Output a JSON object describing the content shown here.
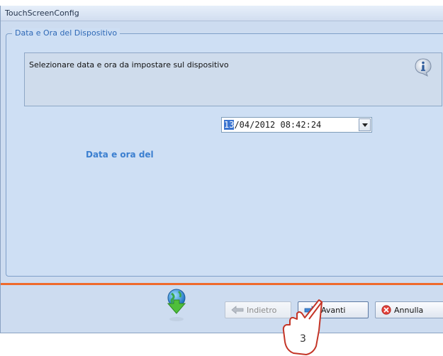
{
  "window": {
    "title": "TouchScreenConfig"
  },
  "group": {
    "title": "Data e Ora del Dispositivo",
    "info_text": "Selezionare data e ora da impostare sul dispositivo"
  },
  "datetime": {
    "label": "Data e ora del",
    "day_selected": "13",
    "rest": "/04/2012 08:42:24"
  },
  "buttons": {
    "back": "Indietro",
    "next": "Avanti",
    "cancel": "Annulla"
  },
  "annotation": {
    "step": "3"
  },
  "icons": [
    "info-icon",
    "chevron-down-icon",
    "globe-download-icon",
    "arrow-left-icon",
    "arrow-right-icon",
    "cancel-icon",
    "pointing-hand-icon"
  ],
  "colors": {
    "accent": "#3b7fd0",
    "separator": "#ef6a2c",
    "legend": "#2f69b6"
  }
}
